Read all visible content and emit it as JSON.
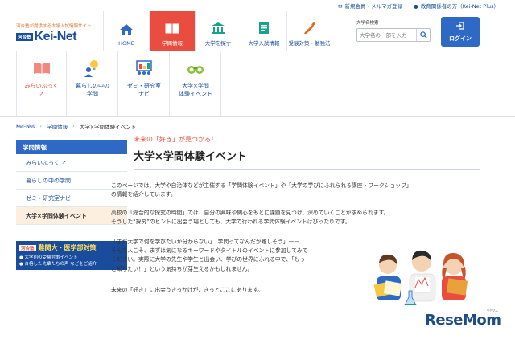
{
  "topbar": {
    "register": "新規会員・メルマガ登録",
    "staff": "教育関係者の方（Kei-Net Plus）"
  },
  "logo": {
    "tagline": "河合塾が提供する大学入試情報サイト",
    "box": "河合塾",
    "name": "Kei-Net"
  },
  "nav": [
    {
      "label": "HOME",
      "icon": "home-icon"
    },
    {
      "label": "学問情報",
      "icon": "book-icon"
    },
    {
      "label": "大学を探す",
      "icon": "university-icon"
    },
    {
      "label": "大学入試情報",
      "icon": "exam-icon"
    },
    {
      "label": "受験対策・勉強法",
      "icon": "pencil-icon"
    }
  ],
  "search": {
    "label": "大学名検索",
    "placeholder": "大学名の一部を入力"
  },
  "login": {
    "label": "ログイン"
  },
  "subnav": [
    {
      "line1": "みらいぶっく",
      "line2": "↗"
    },
    {
      "line1": "暮らしの中の",
      "line2": "学問"
    },
    {
      "line1": "ゼミ・研究室",
      "line2": "ナビ"
    },
    {
      "line1": "大学×学問",
      "line2": "体験イベント"
    }
  ],
  "breadcrumb": {
    "home": "Kei-Net",
    "section": "学問情報",
    "current": "大学×学問体験イベント"
  },
  "sidebar": {
    "heading": "学問情報",
    "items": [
      {
        "label": "みらいぶっく",
        "ext": "↗"
      },
      {
        "label": "暮らしの中の学問",
        "ext": ""
      },
      {
        "label": "ゼミ・研究室ナビ",
        "ext": ""
      },
      {
        "label": "大学×学問体験イベント",
        "ext": ""
      }
    ]
  },
  "banner": {
    "kawai": "河合塾",
    "title": "難関大・医学部対策",
    "line1": "● 大学別の受験対策イベント",
    "line2": "● 合格した先輩たちの声 などをご紹介"
  },
  "main": {
    "catch": "未来の「好き」が見つかる！",
    "title": "大学×学問体験イベント",
    "p1_1": "このページでは、大学や自治体などが主催する「学問体験イベント」や「大学の学びにふれられる講座・ワークショップ」",
    "p1_2": "の情報を紹介しています。",
    "p2_1": "高校の「総合的な探究の時間」では、自分の興味や関心をもとに課題を見つけ、深めていくことが求められます。",
    "p2_2": "そうした“探究”のヒントに出会う場としても、大学で行われる学問体験イベントはぴったりです。",
    "p3_1": "「まだ大学で何を学びたいか分からない」「学問ってなんだか難しそう」——",
    "p3_2": "そんな人こそ、まずは気になるキーワードやタイトルのイベントに参加してみて",
    "p3_3": "ください。実際に大学の先生や学生と出会い、学びの世界にふれる中で、「もっ",
    "p3_4": "と知りたい！」という気持ちが芽生えるかもしれません。",
    "p4": "未来の「好き」に出会うきっかけが、きっとここにあります。"
  },
  "watermark": {
    "text": "ReseMom",
    "kana": "リセマム"
  }
}
